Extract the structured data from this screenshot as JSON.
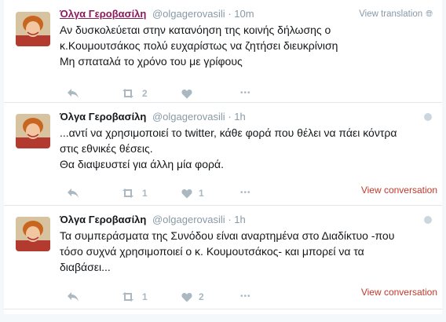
{
  "tweets": [
    {
      "name": "Όλγα Γεροβασίλη",
      "handle": "@olgagerovasili",
      "separator": "·",
      "time": "10m",
      "right_link": "View translation",
      "right_icon": "globe-icon",
      "text_lines": [
        "Αν δυσκολεύεται στην κατανόηση της κοινής δήλωσης ο",
        "κ.Κουμουτσάκος πολύ ευχαρίστως να ζητήσει διευκρίνιση",
        "Μη σπαταλά το χρόνο του με γρίφους"
      ],
      "retweets": "2",
      "likes": "",
      "more": "•••"
    },
    {
      "name": "Όλγα Γεροβασίλη",
      "handle": "@olgagerovasili",
      "separator": "·",
      "time": "1h",
      "text_lines": [
        "...αντί να χρησιμοποιεί το twitter, κάθε φορά που θέλει να πάει κόντρα",
        "στις εθνικές θέσεις.",
        "Θα διαψευστεί για άλλη μία φορά."
      ],
      "retweets": "1",
      "likes": "1",
      "more": "•••",
      "view_conversation": "View conversation"
    },
    {
      "name": "Όλγα Γεροβασίλη",
      "handle": "@olgagerovasili",
      "separator": "·",
      "time": "1h",
      "text_lines": [
        "Τα συμπεράσματα της Συνόδου είναι αναρτημένα στο Διαδίκτυο -που",
        "τόσο συχνά χρησιμοποιεί ο κ. Κουμουτσάκος- και μπορεί να τα",
        "διαβάσει..."
      ],
      "retweets": "1",
      "likes": "2",
      "more": "•••",
      "view_conversation": "View conversation"
    }
  ],
  "colors": {
    "name_highlight": "#8b1a5a",
    "meta": "#8899a6",
    "action": "#aab8c2",
    "link_red": "#c0392b"
  }
}
